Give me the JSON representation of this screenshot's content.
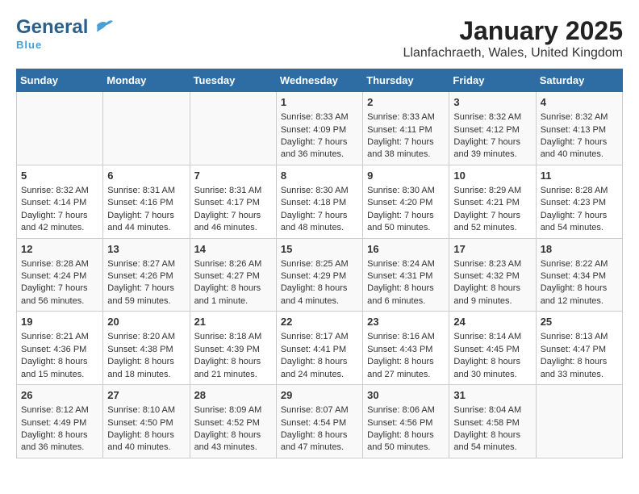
{
  "header": {
    "logo_general": "General",
    "logo_blue": "Blue",
    "title": "January 2025",
    "subtitle": "Llanfachraeth, Wales, United Kingdom"
  },
  "weekdays": [
    "Sunday",
    "Monday",
    "Tuesday",
    "Wednesday",
    "Thursday",
    "Friday",
    "Saturday"
  ],
  "weeks": [
    [
      {
        "day": "",
        "sunrise": "",
        "sunset": "",
        "daylight": ""
      },
      {
        "day": "",
        "sunrise": "",
        "sunset": "",
        "daylight": ""
      },
      {
        "day": "",
        "sunrise": "",
        "sunset": "",
        "daylight": ""
      },
      {
        "day": "1",
        "sunrise": "Sunrise: 8:33 AM",
        "sunset": "Sunset: 4:09 PM",
        "daylight": "Daylight: 7 hours and 36 minutes."
      },
      {
        "day": "2",
        "sunrise": "Sunrise: 8:33 AM",
        "sunset": "Sunset: 4:11 PM",
        "daylight": "Daylight: 7 hours and 38 minutes."
      },
      {
        "day": "3",
        "sunrise": "Sunrise: 8:32 AM",
        "sunset": "Sunset: 4:12 PM",
        "daylight": "Daylight: 7 hours and 39 minutes."
      },
      {
        "day": "4",
        "sunrise": "Sunrise: 8:32 AM",
        "sunset": "Sunset: 4:13 PM",
        "daylight": "Daylight: 7 hours and 40 minutes."
      }
    ],
    [
      {
        "day": "5",
        "sunrise": "Sunrise: 8:32 AM",
        "sunset": "Sunset: 4:14 PM",
        "daylight": "Daylight: 7 hours and 42 minutes."
      },
      {
        "day": "6",
        "sunrise": "Sunrise: 8:31 AM",
        "sunset": "Sunset: 4:16 PM",
        "daylight": "Daylight: 7 hours and 44 minutes."
      },
      {
        "day": "7",
        "sunrise": "Sunrise: 8:31 AM",
        "sunset": "Sunset: 4:17 PM",
        "daylight": "Daylight: 7 hours and 46 minutes."
      },
      {
        "day": "8",
        "sunrise": "Sunrise: 8:30 AM",
        "sunset": "Sunset: 4:18 PM",
        "daylight": "Daylight: 7 hours and 48 minutes."
      },
      {
        "day": "9",
        "sunrise": "Sunrise: 8:30 AM",
        "sunset": "Sunset: 4:20 PM",
        "daylight": "Daylight: 7 hours and 50 minutes."
      },
      {
        "day": "10",
        "sunrise": "Sunrise: 8:29 AM",
        "sunset": "Sunset: 4:21 PM",
        "daylight": "Daylight: 7 hours and 52 minutes."
      },
      {
        "day": "11",
        "sunrise": "Sunrise: 8:28 AM",
        "sunset": "Sunset: 4:23 PM",
        "daylight": "Daylight: 7 hours and 54 minutes."
      }
    ],
    [
      {
        "day": "12",
        "sunrise": "Sunrise: 8:28 AM",
        "sunset": "Sunset: 4:24 PM",
        "daylight": "Daylight: 7 hours and 56 minutes."
      },
      {
        "day": "13",
        "sunrise": "Sunrise: 8:27 AM",
        "sunset": "Sunset: 4:26 PM",
        "daylight": "Daylight: 7 hours and 59 minutes."
      },
      {
        "day": "14",
        "sunrise": "Sunrise: 8:26 AM",
        "sunset": "Sunset: 4:27 PM",
        "daylight": "Daylight: 8 hours and 1 minute."
      },
      {
        "day": "15",
        "sunrise": "Sunrise: 8:25 AM",
        "sunset": "Sunset: 4:29 PM",
        "daylight": "Daylight: 8 hours and 4 minutes."
      },
      {
        "day": "16",
        "sunrise": "Sunrise: 8:24 AM",
        "sunset": "Sunset: 4:31 PM",
        "daylight": "Daylight: 8 hours and 6 minutes."
      },
      {
        "day": "17",
        "sunrise": "Sunrise: 8:23 AM",
        "sunset": "Sunset: 4:32 PM",
        "daylight": "Daylight: 8 hours and 9 minutes."
      },
      {
        "day": "18",
        "sunrise": "Sunrise: 8:22 AM",
        "sunset": "Sunset: 4:34 PM",
        "daylight": "Daylight: 8 hours and 12 minutes."
      }
    ],
    [
      {
        "day": "19",
        "sunrise": "Sunrise: 8:21 AM",
        "sunset": "Sunset: 4:36 PM",
        "daylight": "Daylight: 8 hours and 15 minutes."
      },
      {
        "day": "20",
        "sunrise": "Sunrise: 8:20 AM",
        "sunset": "Sunset: 4:38 PM",
        "daylight": "Daylight: 8 hours and 18 minutes."
      },
      {
        "day": "21",
        "sunrise": "Sunrise: 8:18 AM",
        "sunset": "Sunset: 4:39 PM",
        "daylight": "Daylight: 8 hours and 21 minutes."
      },
      {
        "day": "22",
        "sunrise": "Sunrise: 8:17 AM",
        "sunset": "Sunset: 4:41 PM",
        "daylight": "Daylight: 8 hours and 24 minutes."
      },
      {
        "day": "23",
        "sunrise": "Sunrise: 8:16 AM",
        "sunset": "Sunset: 4:43 PM",
        "daylight": "Daylight: 8 hours and 27 minutes."
      },
      {
        "day": "24",
        "sunrise": "Sunrise: 8:14 AM",
        "sunset": "Sunset: 4:45 PM",
        "daylight": "Daylight: 8 hours and 30 minutes."
      },
      {
        "day": "25",
        "sunrise": "Sunrise: 8:13 AM",
        "sunset": "Sunset: 4:47 PM",
        "daylight": "Daylight: 8 hours and 33 minutes."
      }
    ],
    [
      {
        "day": "26",
        "sunrise": "Sunrise: 8:12 AM",
        "sunset": "Sunset: 4:49 PM",
        "daylight": "Daylight: 8 hours and 36 minutes."
      },
      {
        "day": "27",
        "sunrise": "Sunrise: 8:10 AM",
        "sunset": "Sunset: 4:50 PM",
        "daylight": "Daylight: 8 hours and 40 minutes."
      },
      {
        "day": "28",
        "sunrise": "Sunrise: 8:09 AM",
        "sunset": "Sunset: 4:52 PM",
        "daylight": "Daylight: 8 hours and 43 minutes."
      },
      {
        "day": "29",
        "sunrise": "Sunrise: 8:07 AM",
        "sunset": "Sunset: 4:54 PM",
        "daylight": "Daylight: 8 hours and 47 minutes."
      },
      {
        "day": "30",
        "sunrise": "Sunrise: 8:06 AM",
        "sunset": "Sunset: 4:56 PM",
        "daylight": "Daylight: 8 hours and 50 minutes."
      },
      {
        "day": "31",
        "sunrise": "Sunrise: 8:04 AM",
        "sunset": "Sunset: 4:58 PM",
        "daylight": "Daylight: 8 hours and 54 minutes."
      },
      {
        "day": "",
        "sunrise": "",
        "sunset": "",
        "daylight": ""
      }
    ]
  ]
}
